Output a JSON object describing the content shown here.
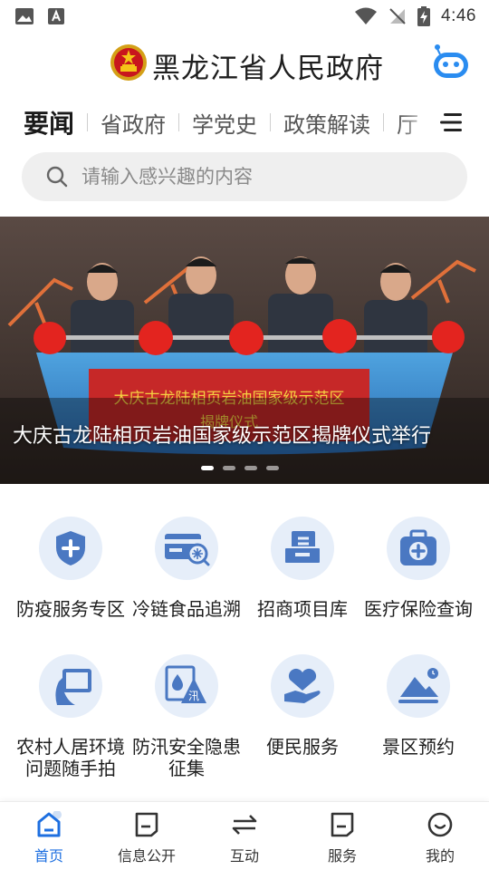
{
  "status_bar": {
    "time": "4:46"
  },
  "header": {
    "title": "黑龙江省人民政府"
  },
  "tabs": [
    {
      "label": "要闻",
      "active": true
    },
    {
      "label": "省政府"
    },
    {
      "label": "学党史"
    },
    {
      "label": "政策解读"
    },
    {
      "label": "厅"
    }
  ],
  "search": {
    "placeholder": "请输入感兴趣的内容"
  },
  "banner": {
    "caption": "大庆古龙陆相页岩油国家级示范区揭牌仪式举行",
    "sign_text": "大庆古龙陆相页岩油国家级示范区",
    "sign_subtext": "揭牌仪式",
    "slide_count": 4,
    "active_slide": 1
  },
  "services": [
    {
      "label": "防疫服务专区",
      "icon": "shield-plus-icon"
    },
    {
      "label": "冷链食品追溯",
      "icon": "cold-chain-card-icon"
    },
    {
      "label": "招商项目库",
      "icon": "project-tray-icon"
    },
    {
      "label": "医疗保险查询",
      "icon": "medical-kit-icon"
    },
    {
      "label_lines": [
        "农村人居环境",
        "问题随手拍"
      ],
      "icon": "phone-in-hand-icon"
    },
    {
      "label_lines": [
        "防汛安全隐患",
        "征集"
      ],
      "icon": "flood-warning-icon",
      "icon_text": "汛"
    },
    {
      "label": "便民服务",
      "icon": "heart-hand-icon"
    },
    {
      "label": "景区预约",
      "icon": "mountain-landscape-icon"
    }
  ],
  "bottom_nav": [
    {
      "label": "首页",
      "icon": "home-icon",
      "active": true
    },
    {
      "label": "信息公开",
      "icon": "info-document-icon"
    },
    {
      "label": "互动",
      "icon": "interaction-arrows-icon"
    },
    {
      "label": "服务",
      "icon": "service-bookmark-icon"
    },
    {
      "label": "我的",
      "icon": "profile-smile-icon"
    }
  ],
  "colors": {
    "accent": "#1d6fe0",
    "icon_blue": "#4a78c2",
    "icon_bg": "#e6eef9"
  }
}
